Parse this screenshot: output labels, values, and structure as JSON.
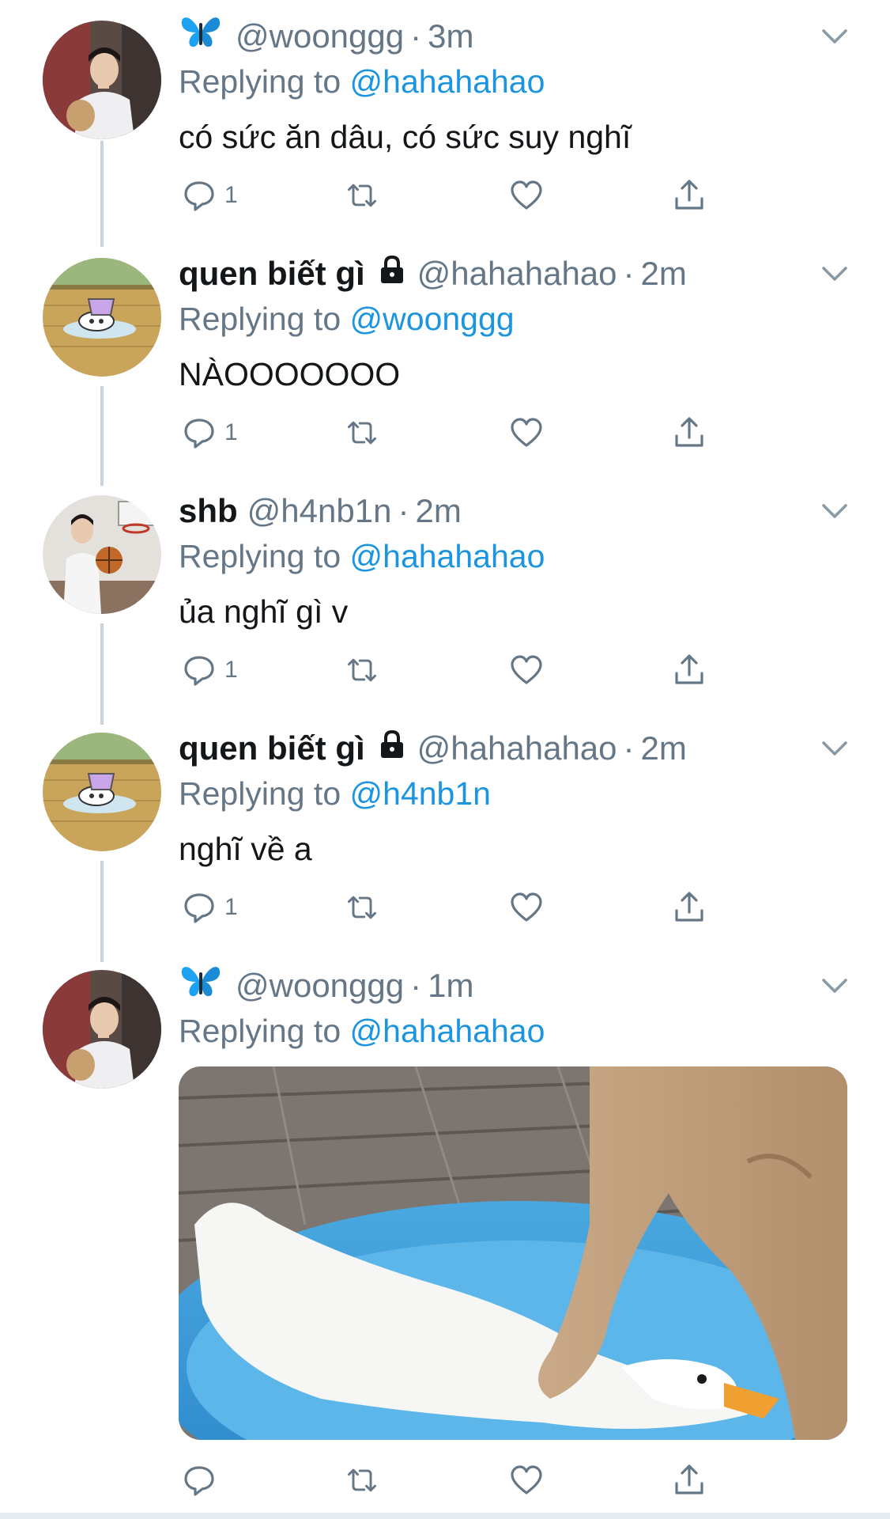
{
  "tweets": [
    {
      "name": "",
      "name_emoji": "butterfly",
      "handle": "@woonggg",
      "time": "3m",
      "replying_prefix": "Replying to",
      "replying_to": "@hahahahao",
      "text": "có sức ăn dâu, có sức suy nghĩ",
      "reply_count": "1",
      "locked": false
    },
    {
      "name": "quen biết gì",
      "handle": "@hahahahao",
      "time": "2m",
      "replying_prefix": "Replying to",
      "replying_to": "@woonggg",
      "text": "NÀOOOOOOO",
      "reply_count": "1",
      "locked": true
    },
    {
      "name": "shb",
      "handle": "@h4nb1n",
      "time": "2m",
      "replying_prefix": "Replying to",
      "replying_to": "@hahahahao",
      "text": "ủa nghĩ gì v",
      "reply_count": "1",
      "locked": false
    },
    {
      "name": "quen biết gì",
      "handle": "@hahahahao",
      "time": "2m",
      "replying_prefix": "Replying to",
      "replying_to": "@h4nb1n",
      "text": "nghĩ về a",
      "reply_count": "1",
      "locked": true
    },
    {
      "name": "",
      "name_emoji": "butterfly",
      "handle": "@woonggg",
      "time": "1m",
      "replying_prefix": "Replying to",
      "replying_to": "@hahahahao",
      "text": "",
      "reply_count": "",
      "locked": false,
      "media": "photo-duck-and-dog-in-blue-pool"
    }
  ],
  "separator": "·",
  "colors": {
    "link": "#1b95e0",
    "secondary": "#657786",
    "thread_line": "#c9d3dc",
    "text": "#14171a"
  },
  "icons": [
    "reply-icon",
    "retweet-icon",
    "like-icon",
    "share-icon",
    "chevron-down-icon",
    "lock-icon",
    "butterfly-icon"
  ]
}
